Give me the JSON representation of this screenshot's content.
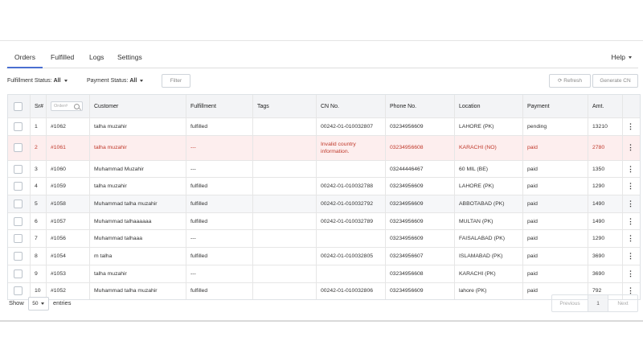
{
  "tabs": [
    {
      "label": "Orders"
    },
    {
      "label": "Fulfilled"
    },
    {
      "label": "Logs"
    },
    {
      "label": "Settings"
    }
  ],
  "help_label": "Help",
  "filters": {
    "fulfillment_label": "Fulfillment Status:",
    "fulfillment_value": "All",
    "payment_label": "Payment Status:",
    "payment_value": "All",
    "filter_button": "Filter",
    "refresh_button": "Refresh",
    "generate_button": "Generate CN"
  },
  "table": {
    "columns": [
      "Sr#",
      "Customer",
      "Fulfillment",
      "Tags",
      "CN No.",
      "Phone No.",
      "Location",
      "Payment",
      "Amt."
    ],
    "order_placeholder": "Order#",
    "rows": [
      {
        "sr": "1",
        "order": "#1062",
        "customer": "talha muzahir",
        "fulfillment": "fulfilled",
        "tags": "",
        "cn": "00242-01-010032807",
        "phone": "03234956609",
        "location": "LAHORE (PK)",
        "payment": "pending",
        "amt": "13210"
      },
      {
        "sr": "2",
        "order": "#1061",
        "customer": "talha muzahir",
        "fulfillment": "---",
        "tags": "",
        "cn": "Invalid country information.",
        "phone": "03234956608",
        "location": "KARACHI (NO)",
        "payment": "paid",
        "amt": "2780"
      },
      {
        "sr": "3",
        "order": "#1060",
        "customer": "Muhammad Muzahir",
        "fulfillment": "---",
        "tags": "",
        "cn": "",
        "phone": "03244446467",
        "location": "60 MIL (BE)",
        "payment": "paid",
        "amt": "1350"
      },
      {
        "sr": "4",
        "order": "#1059",
        "customer": "talha muzahir",
        "fulfillment": "fulfilled",
        "tags": "",
        "cn": "00242-01-010032788",
        "phone": "03234956609",
        "location": "LAHORE (PK)",
        "payment": "paid",
        "amt": "1290"
      },
      {
        "sr": "5",
        "order": "#1058",
        "customer": "Muhammad talha muzahir",
        "fulfillment": "fulfilled",
        "tags": "",
        "cn": "00242-01-010032792",
        "phone": "03234956609",
        "location": "ABBOTABAD (PK)",
        "payment": "paid",
        "amt": "1490"
      },
      {
        "sr": "6",
        "order": "#1057",
        "customer": "Muhammad talhaaaaaa",
        "fulfillment": "fulfilled",
        "tags": "",
        "cn": "00242-01-010032789",
        "phone": "03234956609",
        "location": "MULTAN (PK)",
        "payment": "paid",
        "amt": "1490"
      },
      {
        "sr": "7",
        "order": "#1056",
        "customer": "Muhammad talhaaa",
        "fulfillment": "---",
        "tags": "",
        "cn": "",
        "phone": "03234956609",
        "location": "FAISALABAD (PK)",
        "payment": "paid",
        "amt": "1290"
      },
      {
        "sr": "8",
        "order": "#1054",
        "customer": "m talha",
        "fulfillment": "fulfilled",
        "tags": "",
        "cn": "00242-01-010032805",
        "phone": "03234956607",
        "location": "ISLAMABAD (PK)",
        "payment": "paid",
        "amt": "3690"
      },
      {
        "sr": "9",
        "order": "#1053",
        "customer": "talha muzahir",
        "fulfillment": "---",
        "tags": "",
        "cn": "",
        "phone": "03234956608",
        "location": "KARACHI (PK)",
        "payment": "paid",
        "amt": "3690"
      },
      {
        "sr": "10",
        "order": "#1052",
        "customer": "Muhammad talha muzahir",
        "fulfillment": "fulfilled",
        "tags": "",
        "cn": "00242-01-010032806",
        "phone": "03234956609",
        "location": "lahore (PK)",
        "payment": "paid",
        "amt": "792"
      }
    ]
  },
  "footer": {
    "show_label": "Show",
    "page_size": "50",
    "entries_label": "entries",
    "previous": "Previous",
    "current_page": "1",
    "next": "Next"
  },
  "colors": {
    "accent": "#4a6fd1",
    "error_row_bg": "#fdeeee",
    "error_text": "#c0392b"
  }
}
